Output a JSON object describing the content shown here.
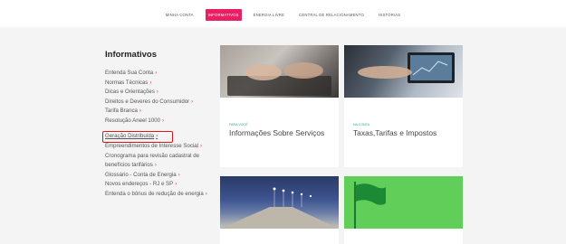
{
  "nav": {
    "items": [
      {
        "label": "Minha conta",
        "active": false
      },
      {
        "label": "Informativos",
        "active": true
      },
      {
        "label": "Energia livre",
        "active": false
      },
      {
        "label": "Central de relacionamento",
        "active": false
      },
      {
        "label": "Histórias",
        "active": false
      }
    ]
  },
  "sidebar": {
    "title": "Informativos",
    "items": [
      {
        "label": "Entenda Sua Conta",
        "icon": "chevron-right-icon"
      },
      {
        "label": "Normas Técnicas",
        "icon": "chevron-right-icon"
      },
      {
        "label": "Dicas e Orientações",
        "icon": "chevron-right-icon"
      },
      {
        "label": "Direitos e Deveres do Consumidor",
        "icon": "chevron-right-icon"
      },
      {
        "label": "Tarifa Branca",
        "icon": "chevron-right-icon"
      },
      {
        "label": "Resolução Aneel 1000",
        "icon": "chevron-right-icon"
      },
      {
        "label": "Geração Distribuída",
        "icon": "chevron-right-icon",
        "highlighted": true
      },
      {
        "label": "Empreendimentos de Interesse Social",
        "icon": "chevron-right-icon"
      },
      {
        "label": "Cronograma para revisão cadastral de benefícios tarifários",
        "icon": "chevron-right-icon"
      },
      {
        "label": "Glossário - Conta de Energia",
        "icon": "chevron-right-icon"
      },
      {
        "label": "Novos endereços - RJ e SP",
        "icon": "chevron-right-icon"
      },
      {
        "label": "Entenda o bônus de redução de energia",
        "icon": "chevron-right-icon"
      }
    ]
  },
  "cards": [
    {
      "category": "Para você",
      "title": "Informações Sobre Serviços",
      "image": "hands-typing-laptop"
    },
    {
      "category": "Na conta",
      "title": "Taxas,Tarifas e Impostos",
      "image": "hand-pointing-laptop-chart"
    },
    {
      "category": "",
      "title": "",
      "image": "street-lights-road"
    },
    {
      "category": "",
      "title": "",
      "image": "green-flag"
    }
  ],
  "colors": {
    "accent": "#e91e63",
    "highlight_box": "#e01616",
    "flag_green": "#62ce5a",
    "category": "#2aa6a0"
  }
}
